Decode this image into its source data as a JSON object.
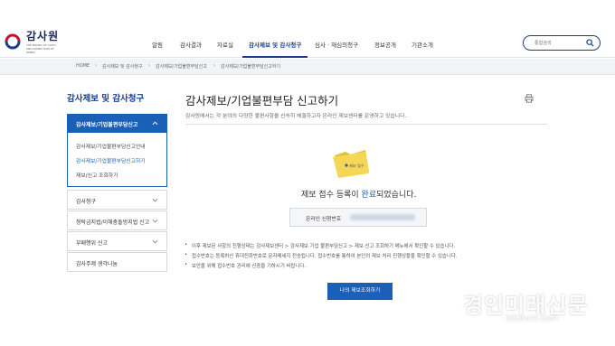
{
  "header": {
    "logo": {
      "name": "감사원",
      "subtitle": "THE BOARD OF AUDIT AND INSPECTION OF KOREA"
    },
    "nav": [
      {
        "label": "알림"
      },
      {
        "label": "감사결과"
      },
      {
        "label": "자료실"
      },
      {
        "label": "감사제보 및 감사청구",
        "active": true
      },
      {
        "label": "심사 · 재심의청구"
      },
      {
        "label": "정보공개"
      },
      {
        "label": "기관소개"
      }
    ],
    "search": {
      "placeholder": "통합검색",
      "icon": "search-icon"
    }
  },
  "breadcrumb": [
    {
      "label": "HOME"
    },
    {
      "label": "감사제보 및 감사청구"
    },
    {
      "label": "감사제보/기업불편부담신고"
    },
    {
      "label": "감사제보/기업불편부담신고하기"
    }
  ],
  "sidebar": {
    "title": "감사제보 및 감사청구",
    "open_group": {
      "label": "감사제보/기업불편부담신고",
      "items": [
        {
          "label": "감사제보/기업불편부담신고안내"
        },
        {
          "label": "감사제보/기업불편부담신고하기",
          "active": true
        },
        {
          "label": "제보/신고 조회하기"
        }
      ]
    },
    "groups": [
      {
        "label": "감사청구"
      },
      {
        "label": "청탁금지법/이해충돌방지법 신고"
      },
      {
        "label": "부패행위 신고"
      },
      {
        "label": "감사주제 생각나눔"
      }
    ]
  },
  "main": {
    "title": "감사제보/기업불편부담 신고하기",
    "description": "감사원에서는 각 분야의 다양한 불편사항을 신속히 해결하고자 온라인 제보센터를 운영하고 있습니다.",
    "folder_label": "제보 접수",
    "done_prefix": "제보 접수 등록이 ",
    "done_highlight": "완료",
    "done_suffix": "되었습니다.",
    "receipt_label": "온라인 신청번호",
    "notes": [
      "이후 제보된 사항의 진행상태는 감사제보센터 > 감사제보·기업 불편부담신고 > 제보·신고 조회하기 메뉴에서 확인할 수 있습니다.",
      "접수번호는 등록하신 휴대전화번호로 문자메세지 전송됩니다. 접수번호를 통하여 본인의 제보 처리 진행상황을 확인할 수 있습니다.",
      "보안을 위해 접수번호 관리에 신중을 기하시기 바랍니다."
    ],
    "button_label": "나의 제보조회하기"
  },
  "watermark": {
    "main": "경인미래신문",
    "sub": "kifuture.com"
  },
  "colors": {
    "primary": "#1a5fb8",
    "navy": "#1a3e8c",
    "folder": "#f2d24a"
  }
}
